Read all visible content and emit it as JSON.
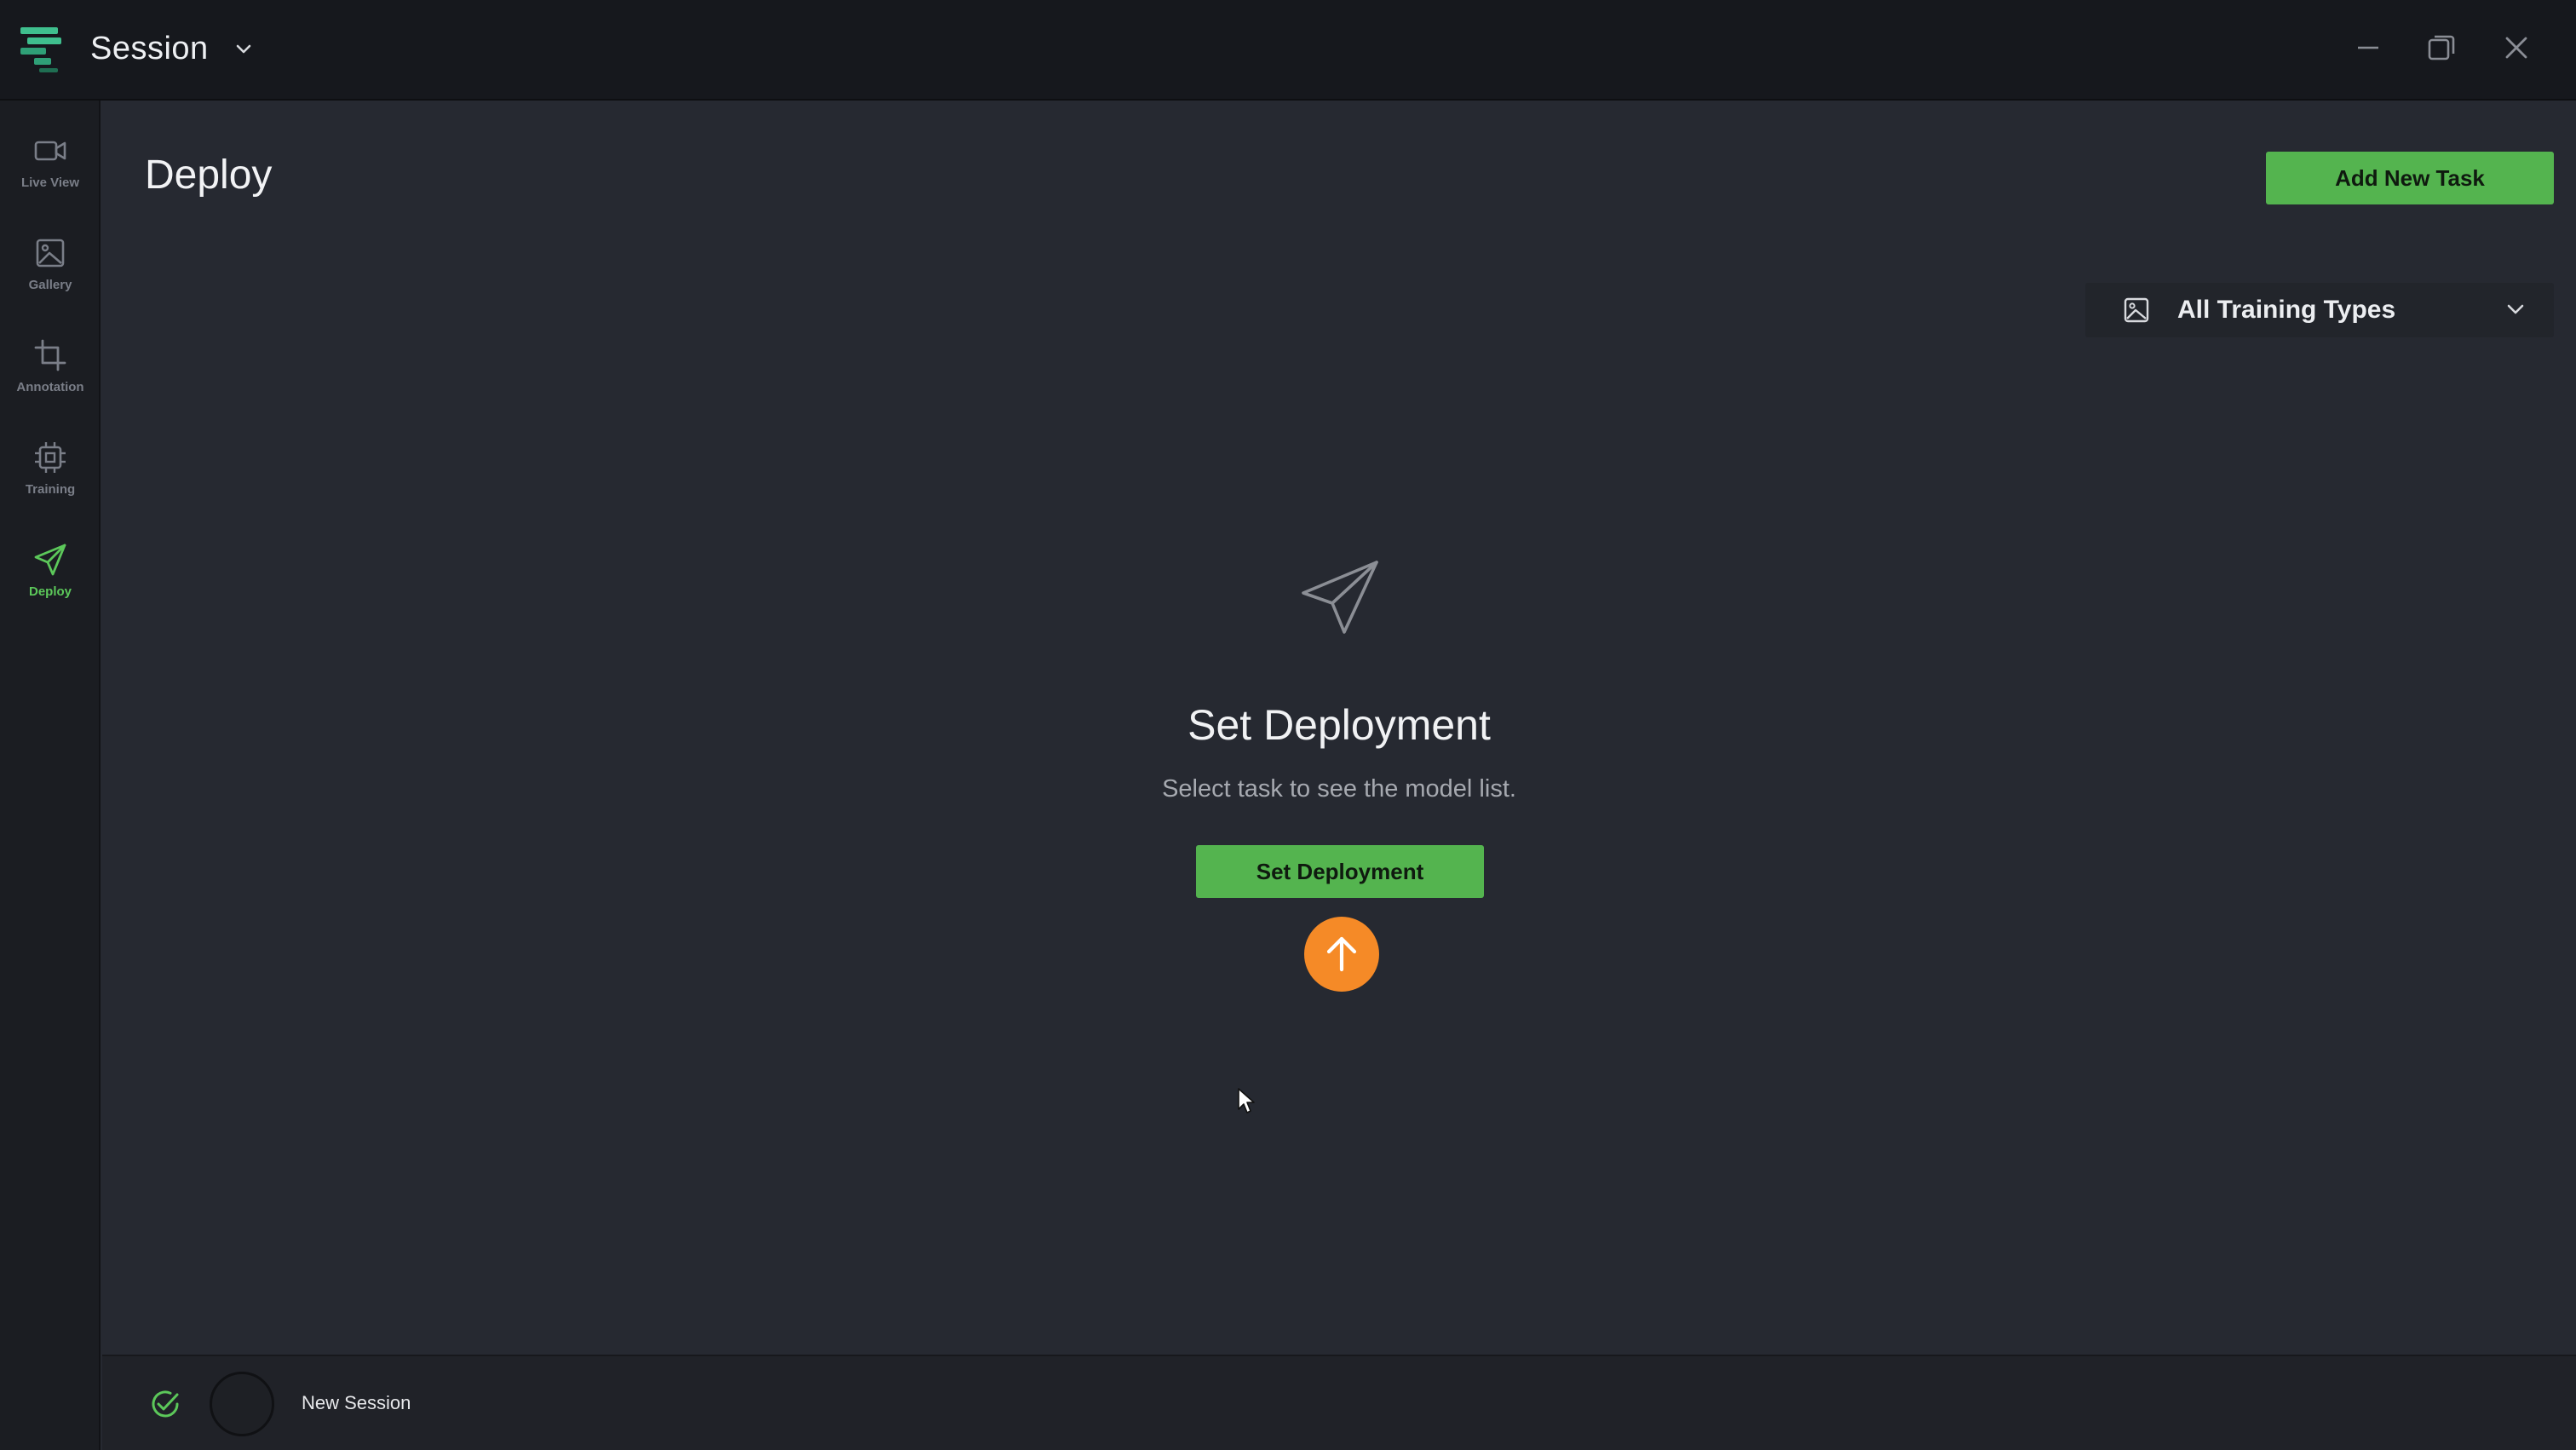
{
  "titlebar": {
    "session_label": "Session"
  },
  "sidebar": {
    "items": [
      {
        "label": "Live View",
        "icon": "video-camera-icon",
        "active": false
      },
      {
        "label": "Gallery",
        "icon": "image-icon",
        "active": false
      },
      {
        "label": "Annotation",
        "icon": "crop-icon",
        "active": false
      },
      {
        "label": "Training",
        "icon": "cpu-chip-icon",
        "active": false
      },
      {
        "label": "Deploy",
        "icon": "paper-plane-icon",
        "active": true
      }
    ]
  },
  "main": {
    "page_title": "Deploy",
    "add_task_label": "Add New Task",
    "training_type_filter": "All Training Types",
    "empty_state": {
      "title": "Set Deployment",
      "subtitle": "Select task to see the model list.",
      "button_label": "Set Deployment"
    }
  },
  "statusbar": {
    "session_name": "New Session"
  },
  "colors": {
    "accent_green": "#54b44f",
    "active_nav": "#5cc85a",
    "upload_orange": "#f58a27",
    "background": "#262931",
    "titlebar": "#16181d"
  }
}
